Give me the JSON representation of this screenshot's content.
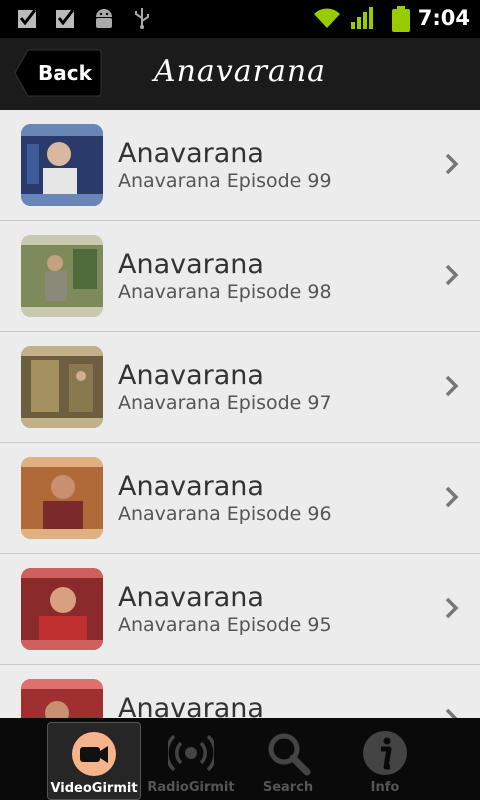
{
  "status_bar": {
    "time": "7:04",
    "icons": [
      "checkbox-notification-icon",
      "checkbox-notification-icon",
      "android-debug-icon",
      "usb-icon",
      "wifi-icon",
      "signal-icon",
      "battery-icon"
    ]
  },
  "header": {
    "back_label": "Back",
    "title": "Anavarana"
  },
  "episodes": [
    {
      "title": "Anavarana",
      "subtitle": "Anavarana Episode 99"
    },
    {
      "title": "Anavarana",
      "subtitle": "Anavarana Episode 98"
    },
    {
      "title": "Anavarana",
      "subtitle": "Anavarana Episode 97"
    },
    {
      "title": "Anavarana",
      "subtitle": "Anavarana Episode 96"
    },
    {
      "title": "Anavarana",
      "subtitle": "Anavarana Episode 95"
    },
    {
      "title": "Anavarana",
      "subtitle": ""
    }
  ],
  "tabs": [
    {
      "label": "VideoGirmit",
      "icon": "video-camera-icon",
      "active": true
    },
    {
      "label": "RadioGirmit",
      "icon": "radio-broadcast-icon",
      "active": false
    },
    {
      "label": "Search",
      "icon": "search-icon",
      "active": false
    },
    {
      "label": "Info",
      "icon": "info-icon",
      "active": false
    }
  ],
  "colors": {
    "header_bg": "#1b1b1b",
    "list_bg": "#ececec",
    "tab_accent": "#f4a261",
    "status_green": "#99cc00"
  }
}
